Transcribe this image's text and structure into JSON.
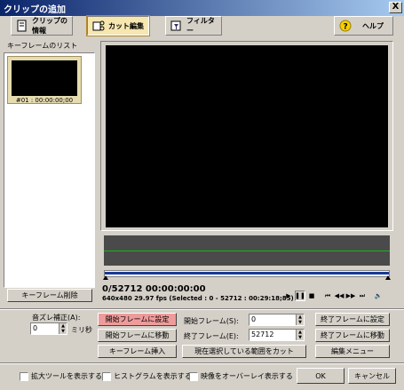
{
  "window": {
    "title": "クリップの追加",
    "close_glyph": "X"
  },
  "toolbar": {
    "clip_info": "クリップの情報",
    "cut_edit": "カット編集",
    "filter": "フィルター",
    "help": "ヘルプ"
  },
  "keyframes": {
    "list_label": "キーフレームのリスト",
    "items": [
      {
        "label": "#01 : 00:00:00;00"
      }
    ],
    "delete_button": "キーフレーム削除"
  },
  "player": {
    "timecode": "0/52712  00:00:00:00",
    "info": "640x480 29.97 fps  (Selected : 0 - 52712 : 00:29:18;85)",
    "controls": {
      "play": "▶",
      "pause": "❚❚",
      "stop": "■",
      "prev_key": "⏮",
      "step_back": "◀◀",
      "step_fwd": "▶▶",
      "next_key": "⏭",
      "volume": "🔈"
    }
  },
  "edit": {
    "sound_offset_label": "音ズレ補正(A):",
    "sound_offset_value": "0",
    "sound_offset_unit": "ミリ秒",
    "set_start": "開始フレームに設定",
    "goto_start": "開始フレームに移動",
    "insert_keyframe": "キーフレーム挿入",
    "start_frame_label": "開始フレーム(S):",
    "start_frame_value": "0",
    "end_frame_label": "終了フレーム(E):",
    "end_frame_value": "52712",
    "cut_selection": "現在選択している範囲をカット",
    "set_end": "終了フレームに設定",
    "goto_end": "終了フレームに移動",
    "edit_menu": "編集メニュー"
  },
  "footer": {
    "show_expand_tools": "拡大ツールを表示する",
    "show_histogram": "ヒストグラムを表示する",
    "overlay_video": "映像をオーバーレイ表示する",
    "ok": "OK",
    "cancel": "キャンセル"
  },
  "colors": {
    "title_gradient_start": "#0a246a",
    "active_tab": "#f6e7b0",
    "start_button": "#ee9b9b",
    "histogram_line": "#1fb01f"
  }
}
